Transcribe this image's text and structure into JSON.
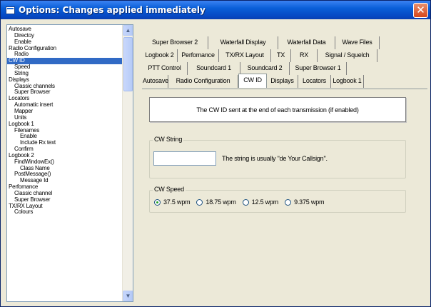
{
  "window": {
    "title": "Options: Changes applied immediately",
    "close_glyph": "✕",
    "icons": {
      "app": "app-icon",
      "close": "close-icon"
    },
    "colors": {
      "titlebar": "#0a5fd8",
      "selection": "#316ac5",
      "close": "#d6461a"
    }
  },
  "tree": {
    "items": [
      {
        "label": "Autosave",
        "indent": 0
      },
      {
        "label": "Directoy",
        "indent": 1
      },
      {
        "label": "Enable",
        "indent": 1
      },
      {
        "label": "Radio Configuration",
        "indent": 0
      },
      {
        "label": "Radio",
        "indent": 1
      },
      {
        "label": "CW ID",
        "indent": 0,
        "selected": true
      },
      {
        "label": "Speed",
        "indent": 1
      },
      {
        "label": "String",
        "indent": 1
      },
      {
        "label": "Displays",
        "indent": 0
      },
      {
        "label": "Classic channels",
        "indent": 1
      },
      {
        "label": "Super Browser",
        "indent": 1
      },
      {
        "label": "Locators",
        "indent": 0
      },
      {
        "label": "Automatic insert",
        "indent": 1
      },
      {
        "label": "Mapper",
        "indent": 1
      },
      {
        "label": "Units",
        "indent": 1
      },
      {
        "label": "Logbook 1",
        "indent": 0
      },
      {
        "label": "Filenames",
        "indent": 1
      },
      {
        "label": "Enable",
        "indent": 2
      },
      {
        "label": "Include Rx text",
        "indent": 2
      },
      {
        "label": "Confirm",
        "indent": 1
      },
      {
        "label": "Logbook 2",
        "indent": 0
      },
      {
        "label": "FindWindowEx()",
        "indent": 1
      },
      {
        "label": "Class Name",
        "indent": 2
      },
      {
        "label": "PostMessage()",
        "indent": 1
      },
      {
        "label": "Message Id",
        "indent": 2
      },
      {
        "label": "Perfomance",
        "indent": 0
      },
      {
        "label": "Classic channel",
        "indent": 1
      },
      {
        "label": "Super Browser",
        "indent": 1
      },
      {
        "label": "TX/RX Layout",
        "indent": 0
      },
      {
        "label": "Colours",
        "indent": 1
      }
    ],
    "scroll_up_glyph": "▲",
    "scroll_down_glyph": "▼"
  },
  "tabs": {
    "rows": [
      [
        {
          "label": "Super Browser 2"
        },
        {
          "label": "Waterfall Display"
        },
        {
          "label": "Waterfall Data"
        },
        {
          "label": "Wave Files"
        }
      ],
      [
        {
          "label": "Logbook 2"
        },
        {
          "label": "Perfomance"
        },
        {
          "label": "TX/RX Layout"
        },
        {
          "label": "TX"
        },
        {
          "label": "RX"
        },
        {
          "label": "Signal / Squelch"
        }
      ],
      [
        {
          "label": "PTT Control"
        },
        {
          "label": "Soundcard 1"
        },
        {
          "label": "Soundcard 2"
        },
        {
          "label": "Super Browser 1"
        }
      ],
      [
        {
          "label": "Autosave"
        },
        {
          "label": "Radio Configuration"
        },
        {
          "label": "CW ID",
          "active": true
        },
        {
          "label": "Displays"
        },
        {
          "label": "Locators"
        },
        {
          "label": "Logbook 1"
        }
      ]
    ]
  },
  "panel": {
    "description": "The CW ID sent at the end of each transmission (if enabled)",
    "cw_string": {
      "group_label": "CW String",
      "input_value": "",
      "hint": "The string is usually \"de Your Callsign\"."
    },
    "cw_speed": {
      "group_label": "CW Speed",
      "options": [
        {
          "label": "37.5 wpm",
          "checked": true
        },
        {
          "label": "18.75 wpm",
          "checked": false
        },
        {
          "label": "12.5 wpm",
          "checked": false
        },
        {
          "label": "9.375 wpm",
          "checked": false
        }
      ]
    }
  }
}
